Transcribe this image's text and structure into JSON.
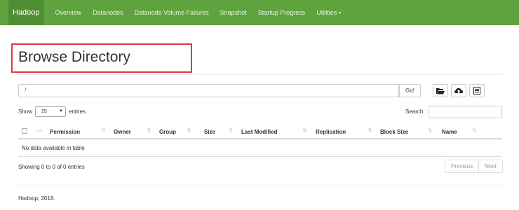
{
  "navbar": {
    "brand": "Hadoop",
    "items": [
      {
        "label": "Overview"
      },
      {
        "label": "Datanodes"
      },
      {
        "label": "Datanode Volume Failures"
      },
      {
        "label": "Snapshot"
      },
      {
        "label": "Startup Progress"
      },
      {
        "label": "Utilities",
        "caret": "▾"
      }
    ]
  },
  "page": {
    "title": "Browse Directory"
  },
  "path_bar": {
    "value": "/",
    "go_label": "Go!",
    "icons": [
      "folder-open-icon",
      "upload-icon",
      "list-icon"
    ]
  },
  "table_controls": {
    "show_label": "Show",
    "entries_value": "25",
    "entries_label": "entries",
    "search_label": "Search:"
  },
  "table": {
    "columns": [
      "Permission",
      "Owner",
      "Group",
      "Size",
      "Last Modified",
      "Replication",
      "Block Size",
      "Name"
    ],
    "empty_message": "No data available in table",
    "info": "Showing 0 to 0 of 0 entries",
    "pagination": {
      "previous": "Previous",
      "next": "Next"
    }
  },
  "footer": {
    "text": "Hadoop, 2018."
  },
  "colors": {
    "navbar": "#5fa33e",
    "highlight_box": "#e0393e"
  }
}
